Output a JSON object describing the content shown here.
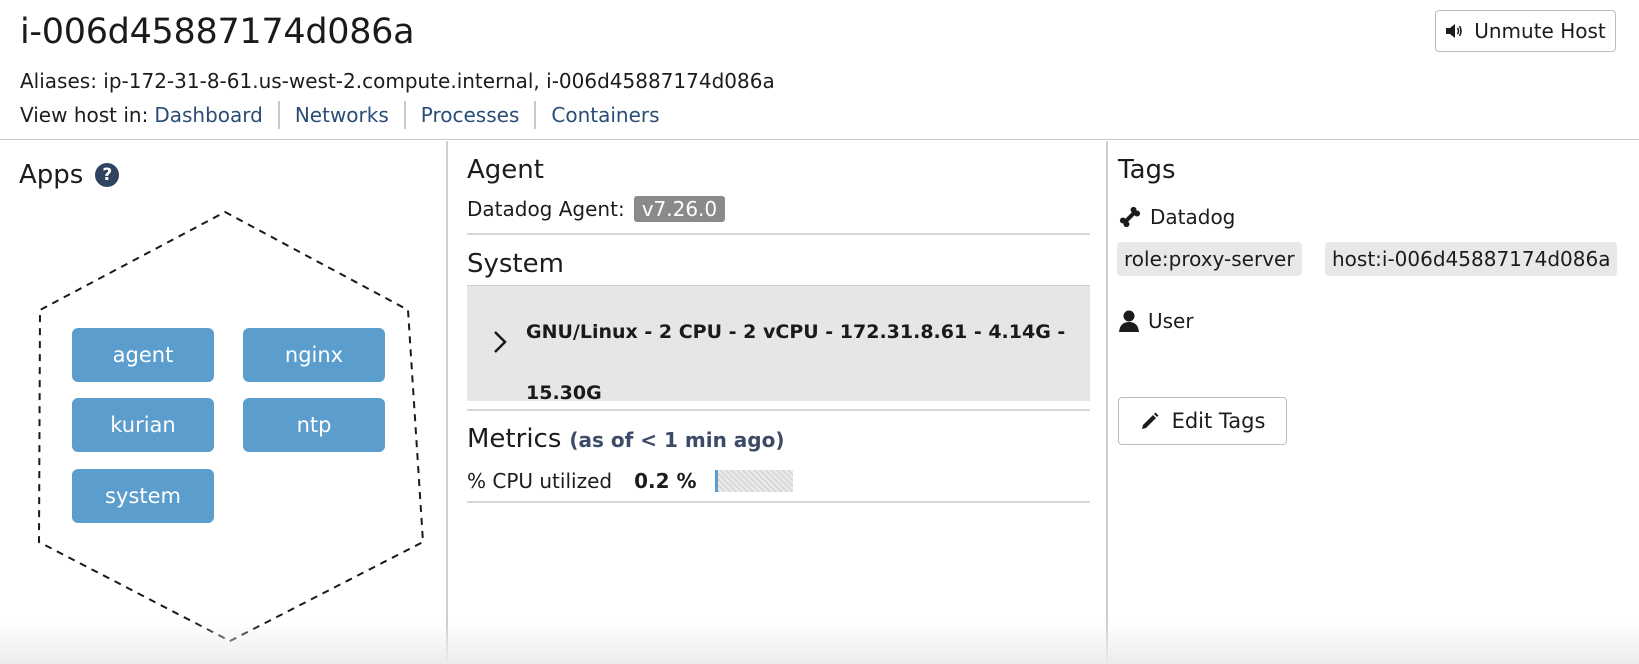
{
  "host": {
    "name": "i-006d45887174d086a",
    "aliases_text": "Aliases: ip-172-31-8-61.us-west-2.compute.internal, i-006d45887174d086a",
    "view_in_label": "View host in:",
    "view_links": [
      "Dashboard",
      "Networks",
      "Processes",
      "Containers"
    ],
    "mute_button_label": "Unmute Host"
  },
  "apps": {
    "title": "Apps",
    "help_glyph": "?",
    "chips": [
      "agent",
      "nginx",
      "kurian",
      "ntp",
      "system"
    ],
    "chip_color": "#5b9dcc"
  },
  "agent": {
    "title": "Agent",
    "label": "Datadog Agent:",
    "version": "v7.26.0"
  },
  "system": {
    "title": "System",
    "line1": "GNU/Linux - 2 CPU - 2 vCPU - 172.31.8.61 - 4.14G -",
    "line2": "15.30G",
    "expand_icon": "chevron-right-icon"
  },
  "metrics": {
    "title": "Metrics",
    "as_of": "(as of < 1 min ago)",
    "cpu_label": "% CPU utilized",
    "cpu_value": "0.2 %",
    "cpu_fraction": 0.002
  },
  "tags": {
    "title": "Tags",
    "datadog_group": {
      "label": "Datadog",
      "icon": "bone-icon",
      "chips": [
        "role:proxy-server",
        "host:i-006d45887174d086a"
      ]
    },
    "user_group": {
      "label": "User",
      "icon": "user-icon"
    },
    "edit_button_label": "Edit Tags",
    "edit_icon": "pencil-icon"
  }
}
